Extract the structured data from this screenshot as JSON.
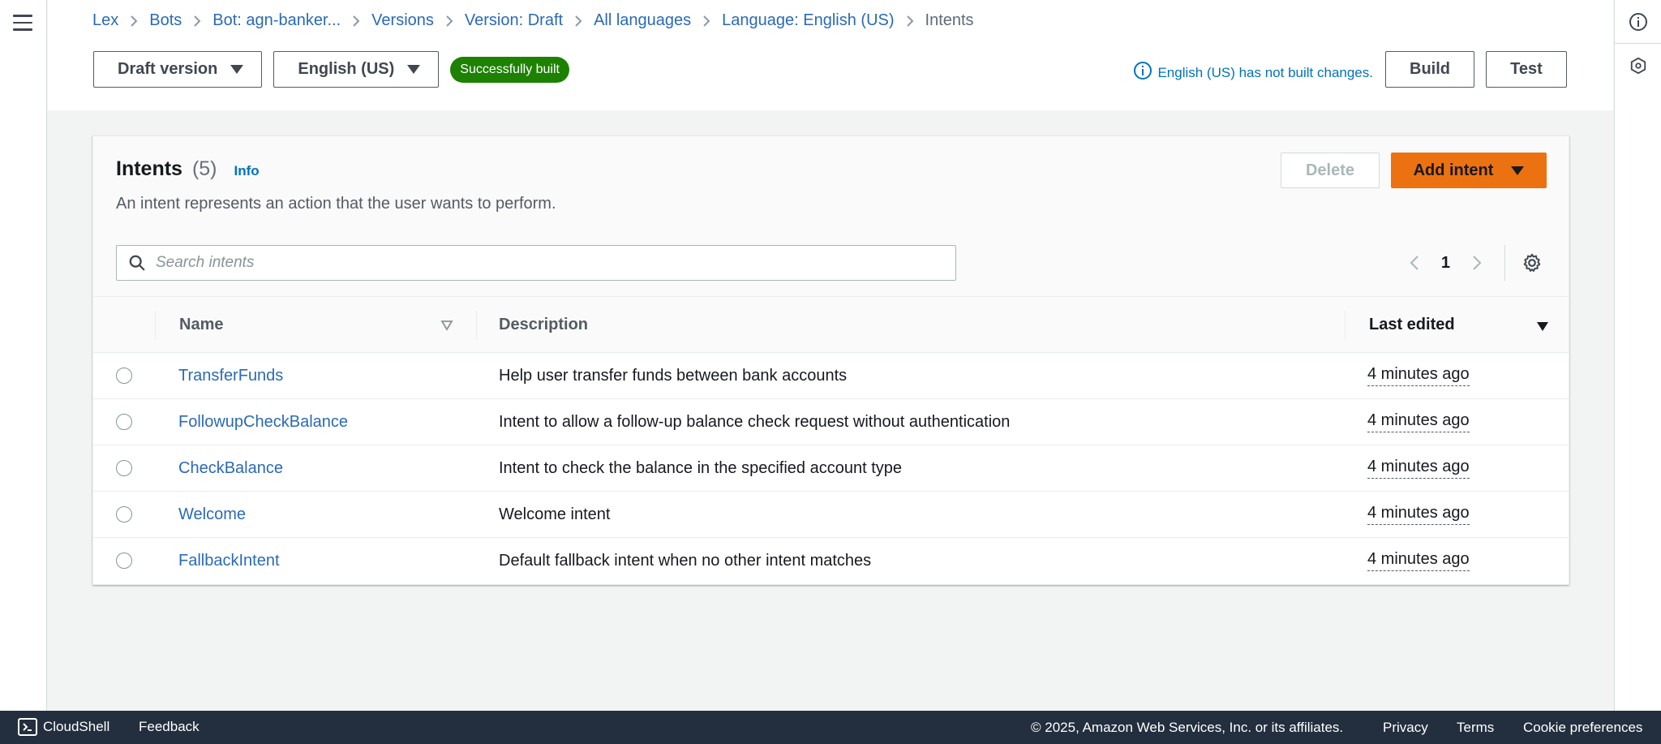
{
  "breadcrumbs": [
    {
      "label": "Lex"
    },
    {
      "label": "Bots"
    },
    {
      "label": "Bot: agn-banker..."
    },
    {
      "label": "Versions"
    },
    {
      "label": "Version: Draft"
    },
    {
      "label": "All languages"
    },
    {
      "label": "Language: English (US)"
    },
    {
      "label": "Intents"
    }
  ],
  "version_bar": {
    "version_dropdown": "Draft version",
    "language_dropdown": "English (US)",
    "build_badge": "Successfully built"
  },
  "header": {
    "build_status": "English (US) has not built changes.",
    "build_button": "Build",
    "test_button": "Test"
  },
  "intents_panel": {
    "title": "Intents",
    "count": "(5)",
    "info_link": "Info",
    "description": "An intent represents an action that the user wants to perform.",
    "delete_button": "Delete",
    "add_button": "Add intent",
    "search_placeholder": "Search intents",
    "current_page": "1",
    "columns": {
      "name": "Name",
      "description": "Description",
      "last_edited": "Last edited"
    },
    "rows": [
      {
        "name": "TransferFunds",
        "description": "Help user transfer funds between bank accounts",
        "last_edited": "4 minutes ago"
      },
      {
        "name": "FollowupCheckBalance",
        "description": "Intent to allow a follow-up balance check request without authentication",
        "last_edited": "4 minutes ago"
      },
      {
        "name": "CheckBalance",
        "description": "Intent to check the balance in the specified account type",
        "last_edited": "4 minutes ago"
      },
      {
        "name": "Welcome",
        "description": "Welcome intent",
        "last_edited": "4 minutes ago"
      },
      {
        "name": "FallbackIntent",
        "description": "Default fallback intent when no other intent matches",
        "last_edited": "4 minutes ago"
      }
    ]
  },
  "footer": {
    "cloudshell": "CloudShell",
    "feedback": "Feedback",
    "copyright": "© 2025, Amazon Web Services, Inc. or its affiliates.",
    "privacy": "Privacy",
    "terms": "Terms",
    "cookie_preferences": "Cookie preferences"
  },
  "colors": {
    "link": "#2a6ab5",
    "primary_button": "#ec7211",
    "success_badge": "#1d8102",
    "footer_bg": "#232f3e"
  }
}
